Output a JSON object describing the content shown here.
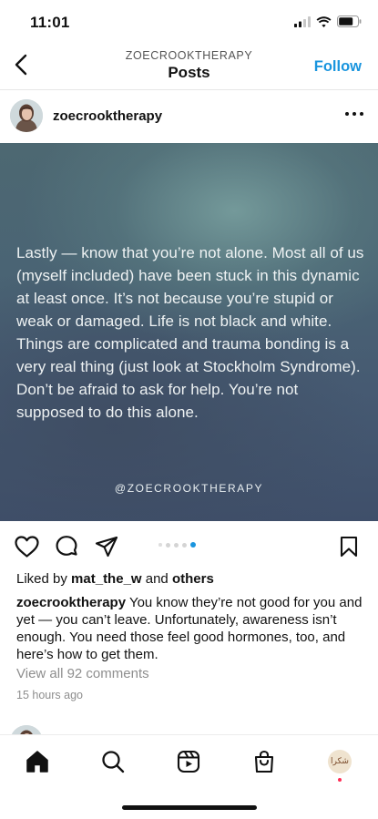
{
  "status_bar": {
    "time": "11:01"
  },
  "header": {
    "subtitle": "ZOECROOKTHERAPY",
    "title": "Posts",
    "follow_label": "Follow"
  },
  "post": {
    "author": "zoecrooktherapy",
    "image_text": "Lastly — know that you’re not alone. Most all of us (myself included) have been stuck in this dynamic at least once. It’s not because you’re stupid or weak or damaged. Life is not black and white. Things are complicated and trauma bonding is a very real thing (just look at Stockholm Syndrome). Don’t be afraid to ask for help. You’re not supposed to do this alone.",
    "image_handle": "@ZOECROOKTHERAPY",
    "carousel": {
      "count": 5,
      "active_index": 4
    },
    "likes_prefix": "Liked by ",
    "likes_user": "mat_the_w",
    "likes_and": " and ",
    "likes_others": "others",
    "caption_author": "zoecrooktherapy",
    "caption_text": " You know they’re not good for you and yet — you can’t leave. Unfortunately, awareness isn’t enough. You need those feel good hormones, too, and here’s how to get them.",
    "view_comments": "View all 92 comments",
    "timestamp": "15 hours ago"
  },
  "nav": {
    "items": [
      "home",
      "search",
      "reels",
      "shop",
      "profile"
    ],
    "profile_avatar_text": "شكرا"
  },
  "colors": {
    "accent": "#1a95de",
    "notification": "#ff2d55",
    "muted": "#8e8e8e"
  }
}
